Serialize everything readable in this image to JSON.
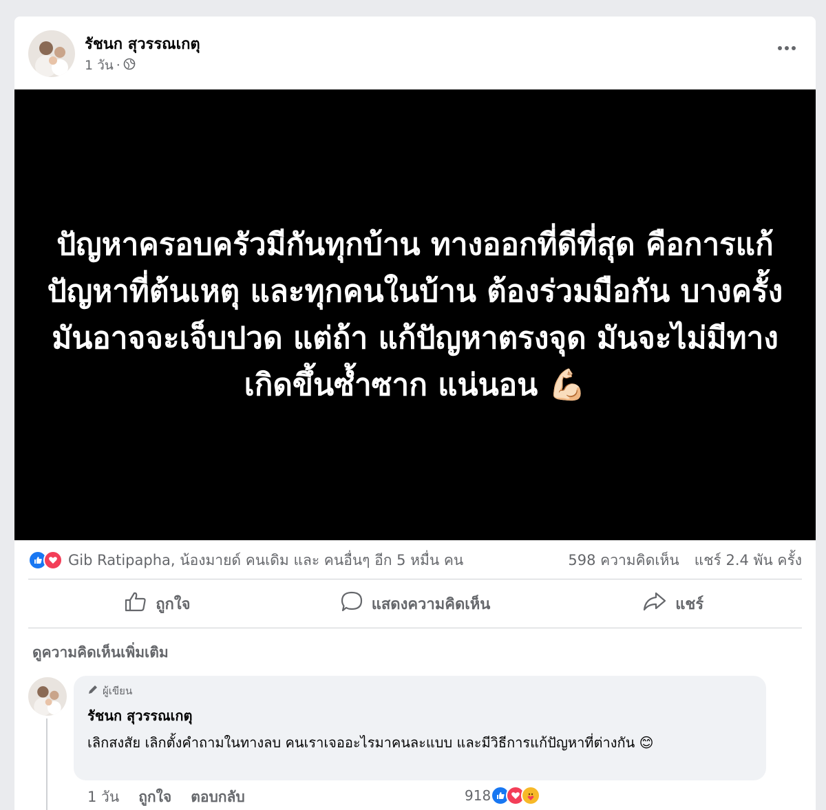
{
  "post": {
    "author": "รัชนก สุวรรณเกตุ",
    "time": "1 วัน",
    "privacy_icon": "globe-icon",
    "text": "ปัญหาครอบครัวมีกันทุกบ้าน ทางออกที่ดีที่สุด คือการแก้ปัญหาที่ต้นเหตุ และทุกคนในบ้าน ต้องร่วมมือกัน บางครั้งมันอาจจะเจ็บปวด แต่ถ้า แก้ปัญหาตรงจุด มันจะไม่มีทางเกิดขึ้นซ้ำซาก แน่นอน 💪🏻"
  },
  "stats": {
    "reactions_text": "Gib Ratipapha, น้องมายด์ คนเดิม และ คนอื่นๆ อีก 5 หมื่น คน",
    "comments": "598 ความคิดเห็น",
    "shares": "แชร์ 2.4 พัน ครั้ง"
  },
  "actions": {
    "like": "ถูกใจ",
    "comment": "แสดงความคิดเห็น",
    "share": "แชร์"
  },
  "comments_section": {
    "view_more": "ดูความคิดเห็นเพิ่มเติม",
    "comment": {
      "badge": "ผู้เขียน",
      "author": "รัชนก สุวรรณเกตุ",
      "text": "เลิกสงสัย เลิกตั้งคำถามในทางลบ คนเราเจออะไรมาคนละแบบ และมีวิธีการแก้ปัญหาที่ต่างกัน 😊",
      "time": "1 วัน",
      "like": "ถูกใจ",
      "reply": "ตอบกลับ",
      "reaction_count": "918"
    }
  },
  "colors": {
    "like_blue": "#1877f2",
    "love_red": "#f33e58",
    "care_yellow": "#f7b928",
    "muted_text": "#65676b"
  }
}
